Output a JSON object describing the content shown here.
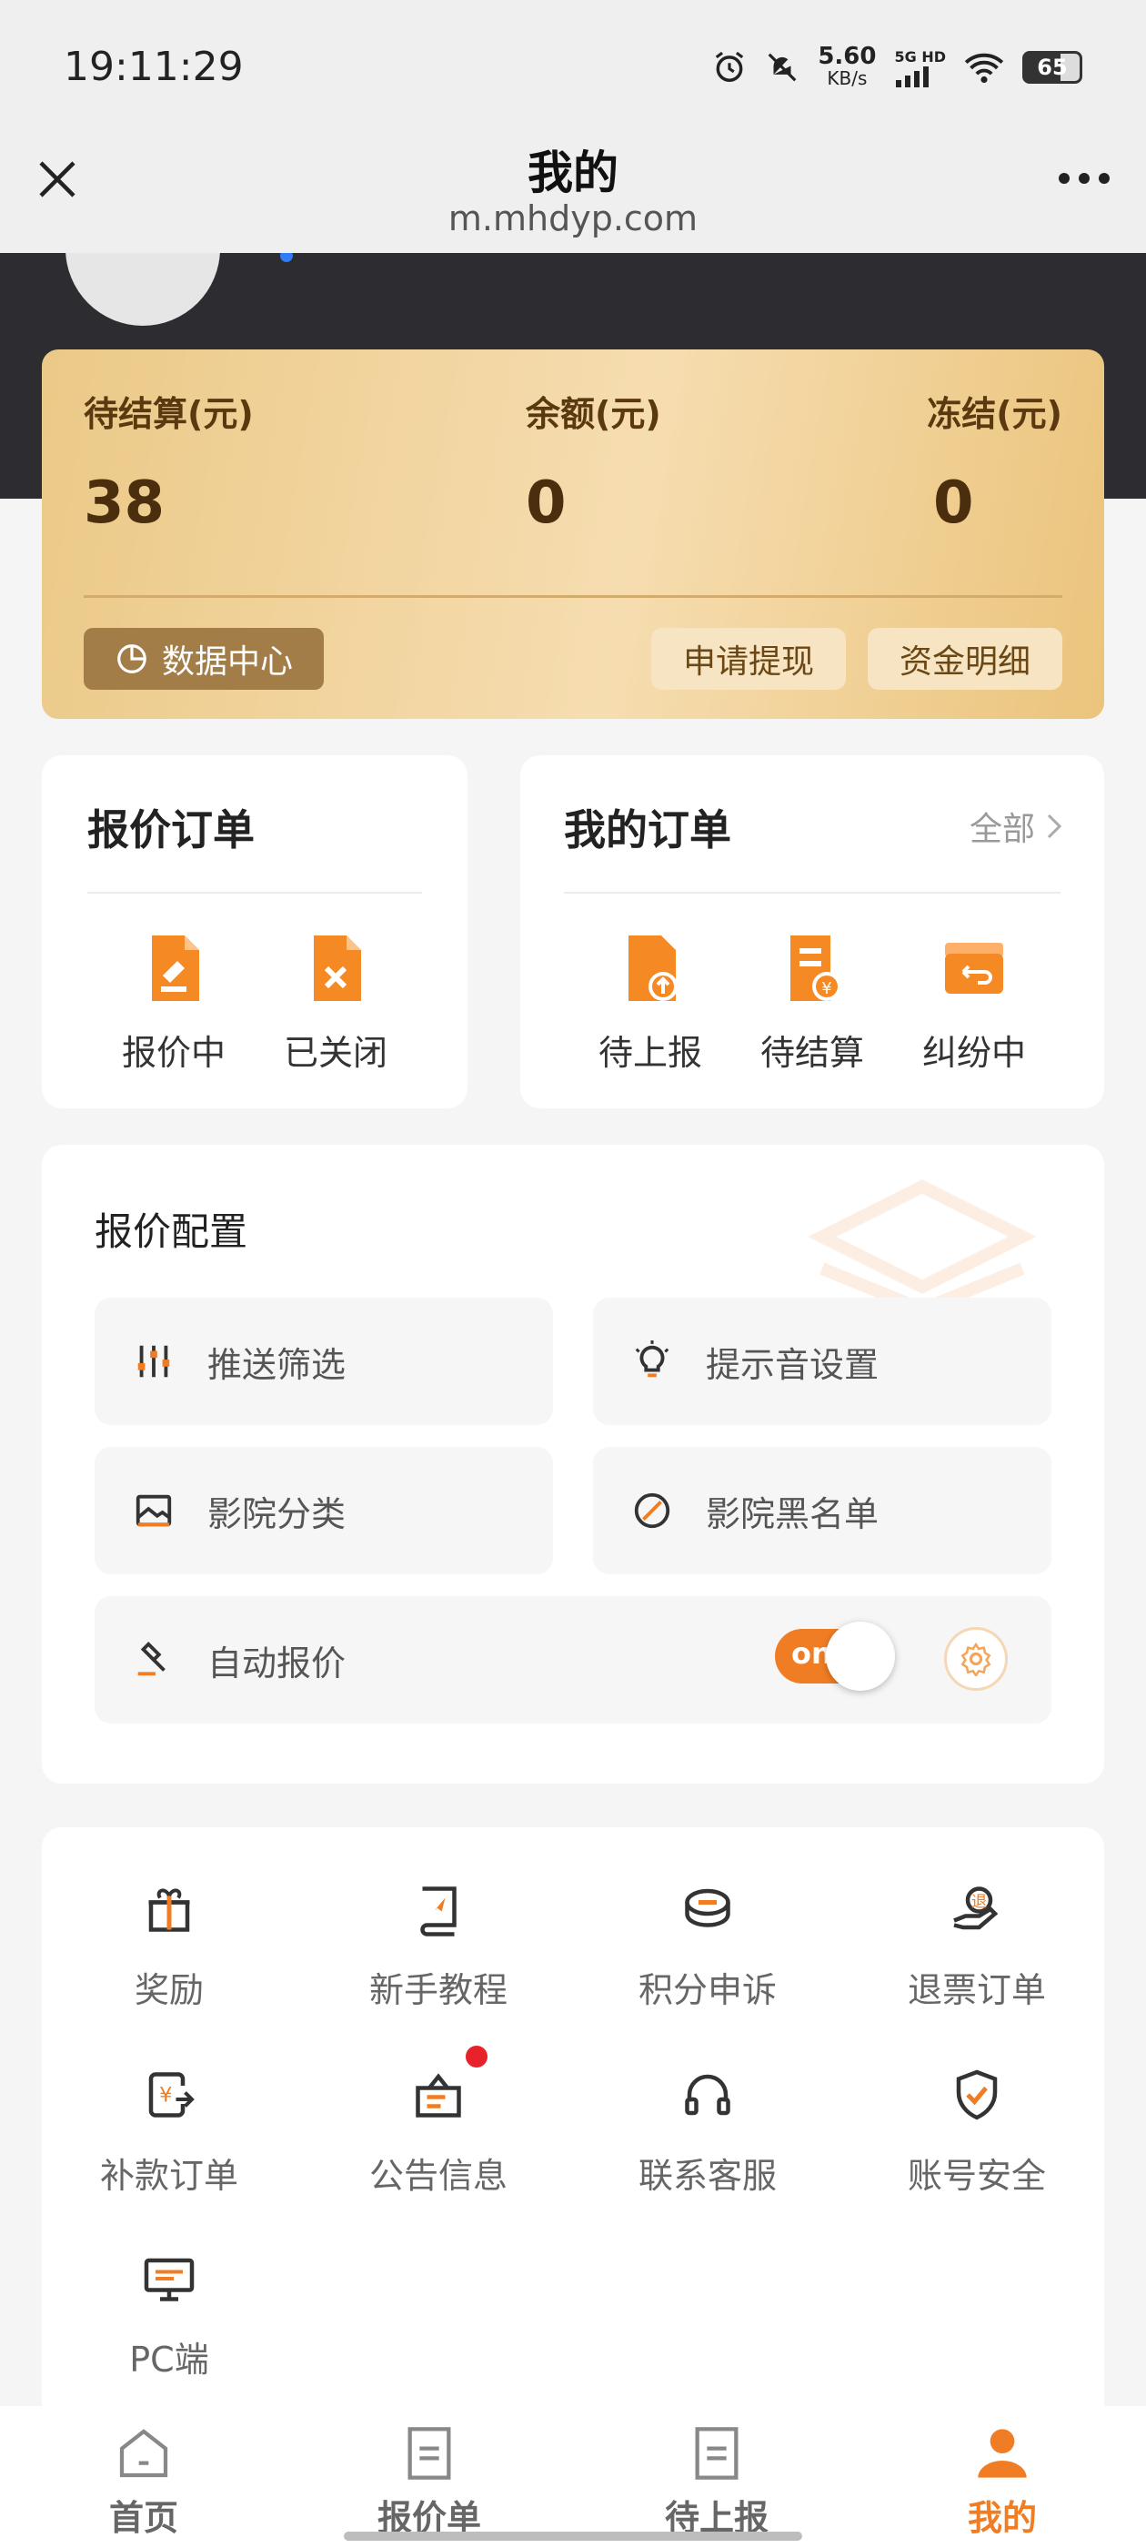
{
  "status_bar": {
    "time": "19:11:29",
    "net_speed": "5.60",
    "net_unit": "KB/s",
    "net_type": "5G HD",
    "battery": "65"
  },
  "nav": {
    "title": "我的",
    "url": "m.mhdyp.com"
  },
  "balance": {
    "pending_label": "待结算(元)",
    "pending_value": "38",
    "balance_label": "余额(元)",
    "balance_value": "0",
    "frozen_label": "冻结(元)",
    "frozen_value": "0",
    "data_center": "数据中心",
    "withdraw": "申请提现",
    "fund_detail": "资金明细"
  },
  "quote_orders": {
    "title": "报价订单",
    "items": [
      "报价中",
      "已关闭"
    ]
  },
  "my_orders": {
    "title": "我的订单",
    "all": "全部",
    "items": [
      "待上报",
      "待结算",
      "纠纷中"
    ]
  },
  "config": {
    "title": "报价配置",
    "tiles": [
      "推送筛选",
      "提示音设置",
      "影院分类",
      "影院黑名单"
    ],
    "auto_quote": "自动报价",
    "toggle": "on"
  },
  "tools": [
    "奖励",
    "新手教程",
    "积分申诉",
    "退票订单",
    "补款订单",
    "公告信息",
    "联系客服",
    "账号安全",
    "PC端"
  ],
  "bottom_nav": [
    "首页",
    "报价单",
    "待上报",
    "我的"
  ],
  "colors": {
    "accent": "#f07d24",
    "gold": "#ebc987",
    "dark": "#2d2c30"
  }
}
